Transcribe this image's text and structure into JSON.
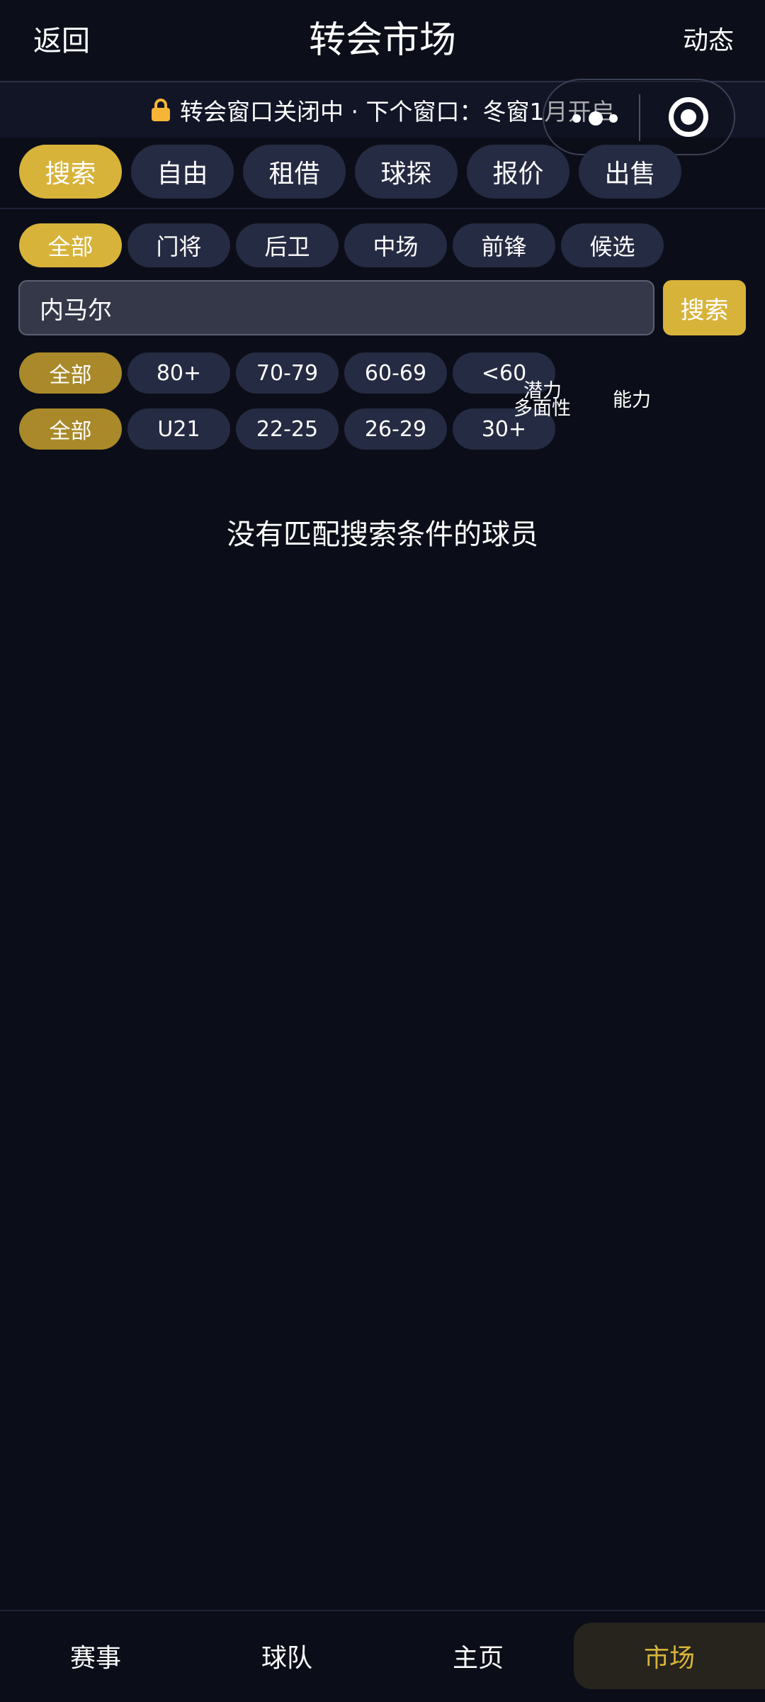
{
  "header": {
    "back_label": "返回",
    "title": "转会市场",
    "feed_label": "动态"
  },
  "notice": {
    "text": "转会窗口关闭中 · 下个窗口：冬窗1月开启"
  },
  "tabs": [
    {
      "label": "搜索",
      "active": true
    },
    {
      "label": "自由",
      "active": false
    },
    {
      "label": "租借",
      "active": false
    },
    {
      "label": "球探",
      "active": false
    },
    {
      "label": "报价",
      "active": false
    },
    {
      "label": "出售",
      "active": false
    }
  ],
  "positions": [
    {
      "label": "全部",
      "active": true
    },
    {
      "label": "门将",
      "active": false
    },
    {
      "label": "后卫",
      "active": false
    },
    {
      "label": "中场",
      "active": false
    },
    {
      "label": "前锋",
      "active": false
    },
    {
      "label": "候选",
      "active": false
    }
  ],
  "search": {
    "value": "内马尔",
    "button_label": "搜索"
  },
  "rating_filters": [
    {
      "label": "全部",
      "active": true
    },
    {
      "label": "80+",
      "active": false
    },
    {
      "label": "70-79",
      "active": false
    },
    {
      "label": "60-69",
      "active": false
    },
    {
      "label": "<60",
      "active": false
    }
  ],
  "age_filters": [
    {
      "label": "全部",
      "active": true
    },
    {
      "label": "U21",
      "active": false
    },
    {
      "label": "22-25",
      "active": false
    },
    {
      "label": "26-29",
      "active": false
    },
    {
      "label": "30+",
      "active": false
    }
  ],
  "sort_labels": {
    "potential": "潜力",
    "versatility": "多面性",
    "ability": "能力"
  },
  "empty_message": "没有匹配搜索条件的球员",
  "bottom_nav": [
    {
      "label": "赛事",
      "active": false
    },
    {
      "label": "球队",
      "active": false
    },
    {
      "label": "主页",
      "active": false
    },
    {
      "label": "市场",
      "active": true
    }
  ],
  "colors": {
    "accent": "#d8b33a",
    "accent_dim": "#a9892a",
    "chip_bg": "#252b42",
    "page_bg": "#0b0e18",
    "lock": "#f6b536"
  }
}
